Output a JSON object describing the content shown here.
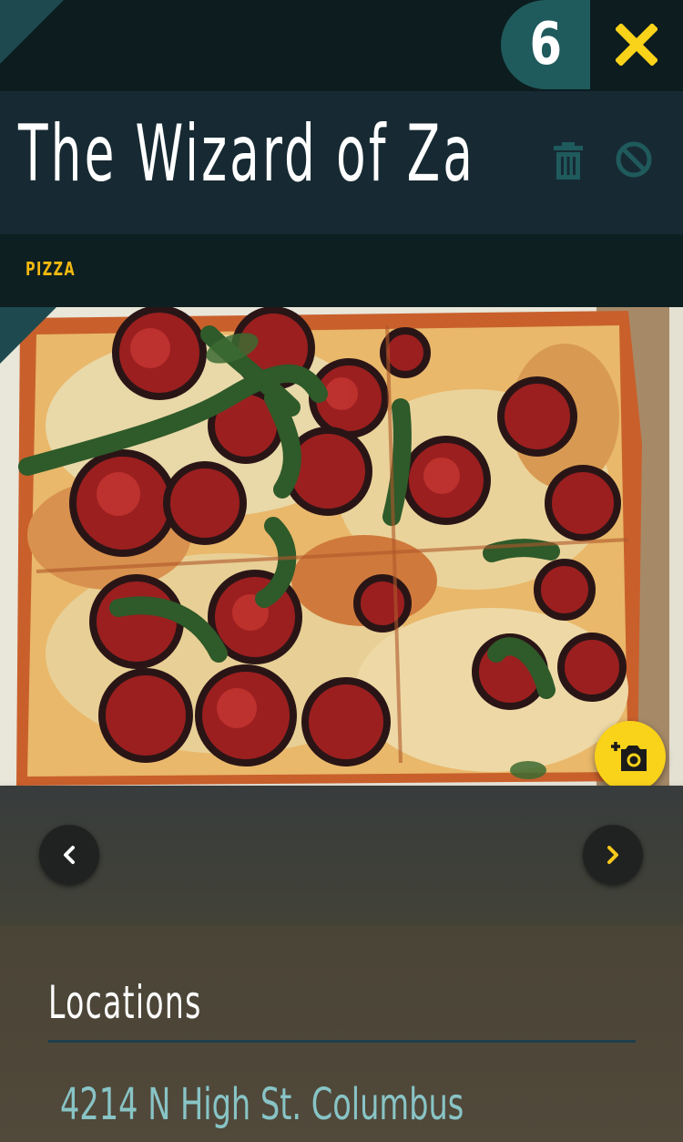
{
  "header": {
    "badge_count": "6",
    "title": "The Wizard of Za",
    "category": "PIZZA"
  },
  "icons": {
    "close": "close-icon",
    "trash": "trash-icon",
    "block": "block-icon",
    "camera": "add-photo-icon",
    "prev": "chevron-left-icon",
    "next": "chevron-right-icon"
  },
  "colors": {
    "accent_yellow": "#f9d21a",
    "badge_teal": "#1f5a5c",
    "header_dark": "#172a33",
    "address_teal": "#88c4c6"
  },
  "locations": {
    "heading": "Locations",
    "items": [
      {
        "address": "4214 N High St. Columbus"
      }
    ]
  }
}
